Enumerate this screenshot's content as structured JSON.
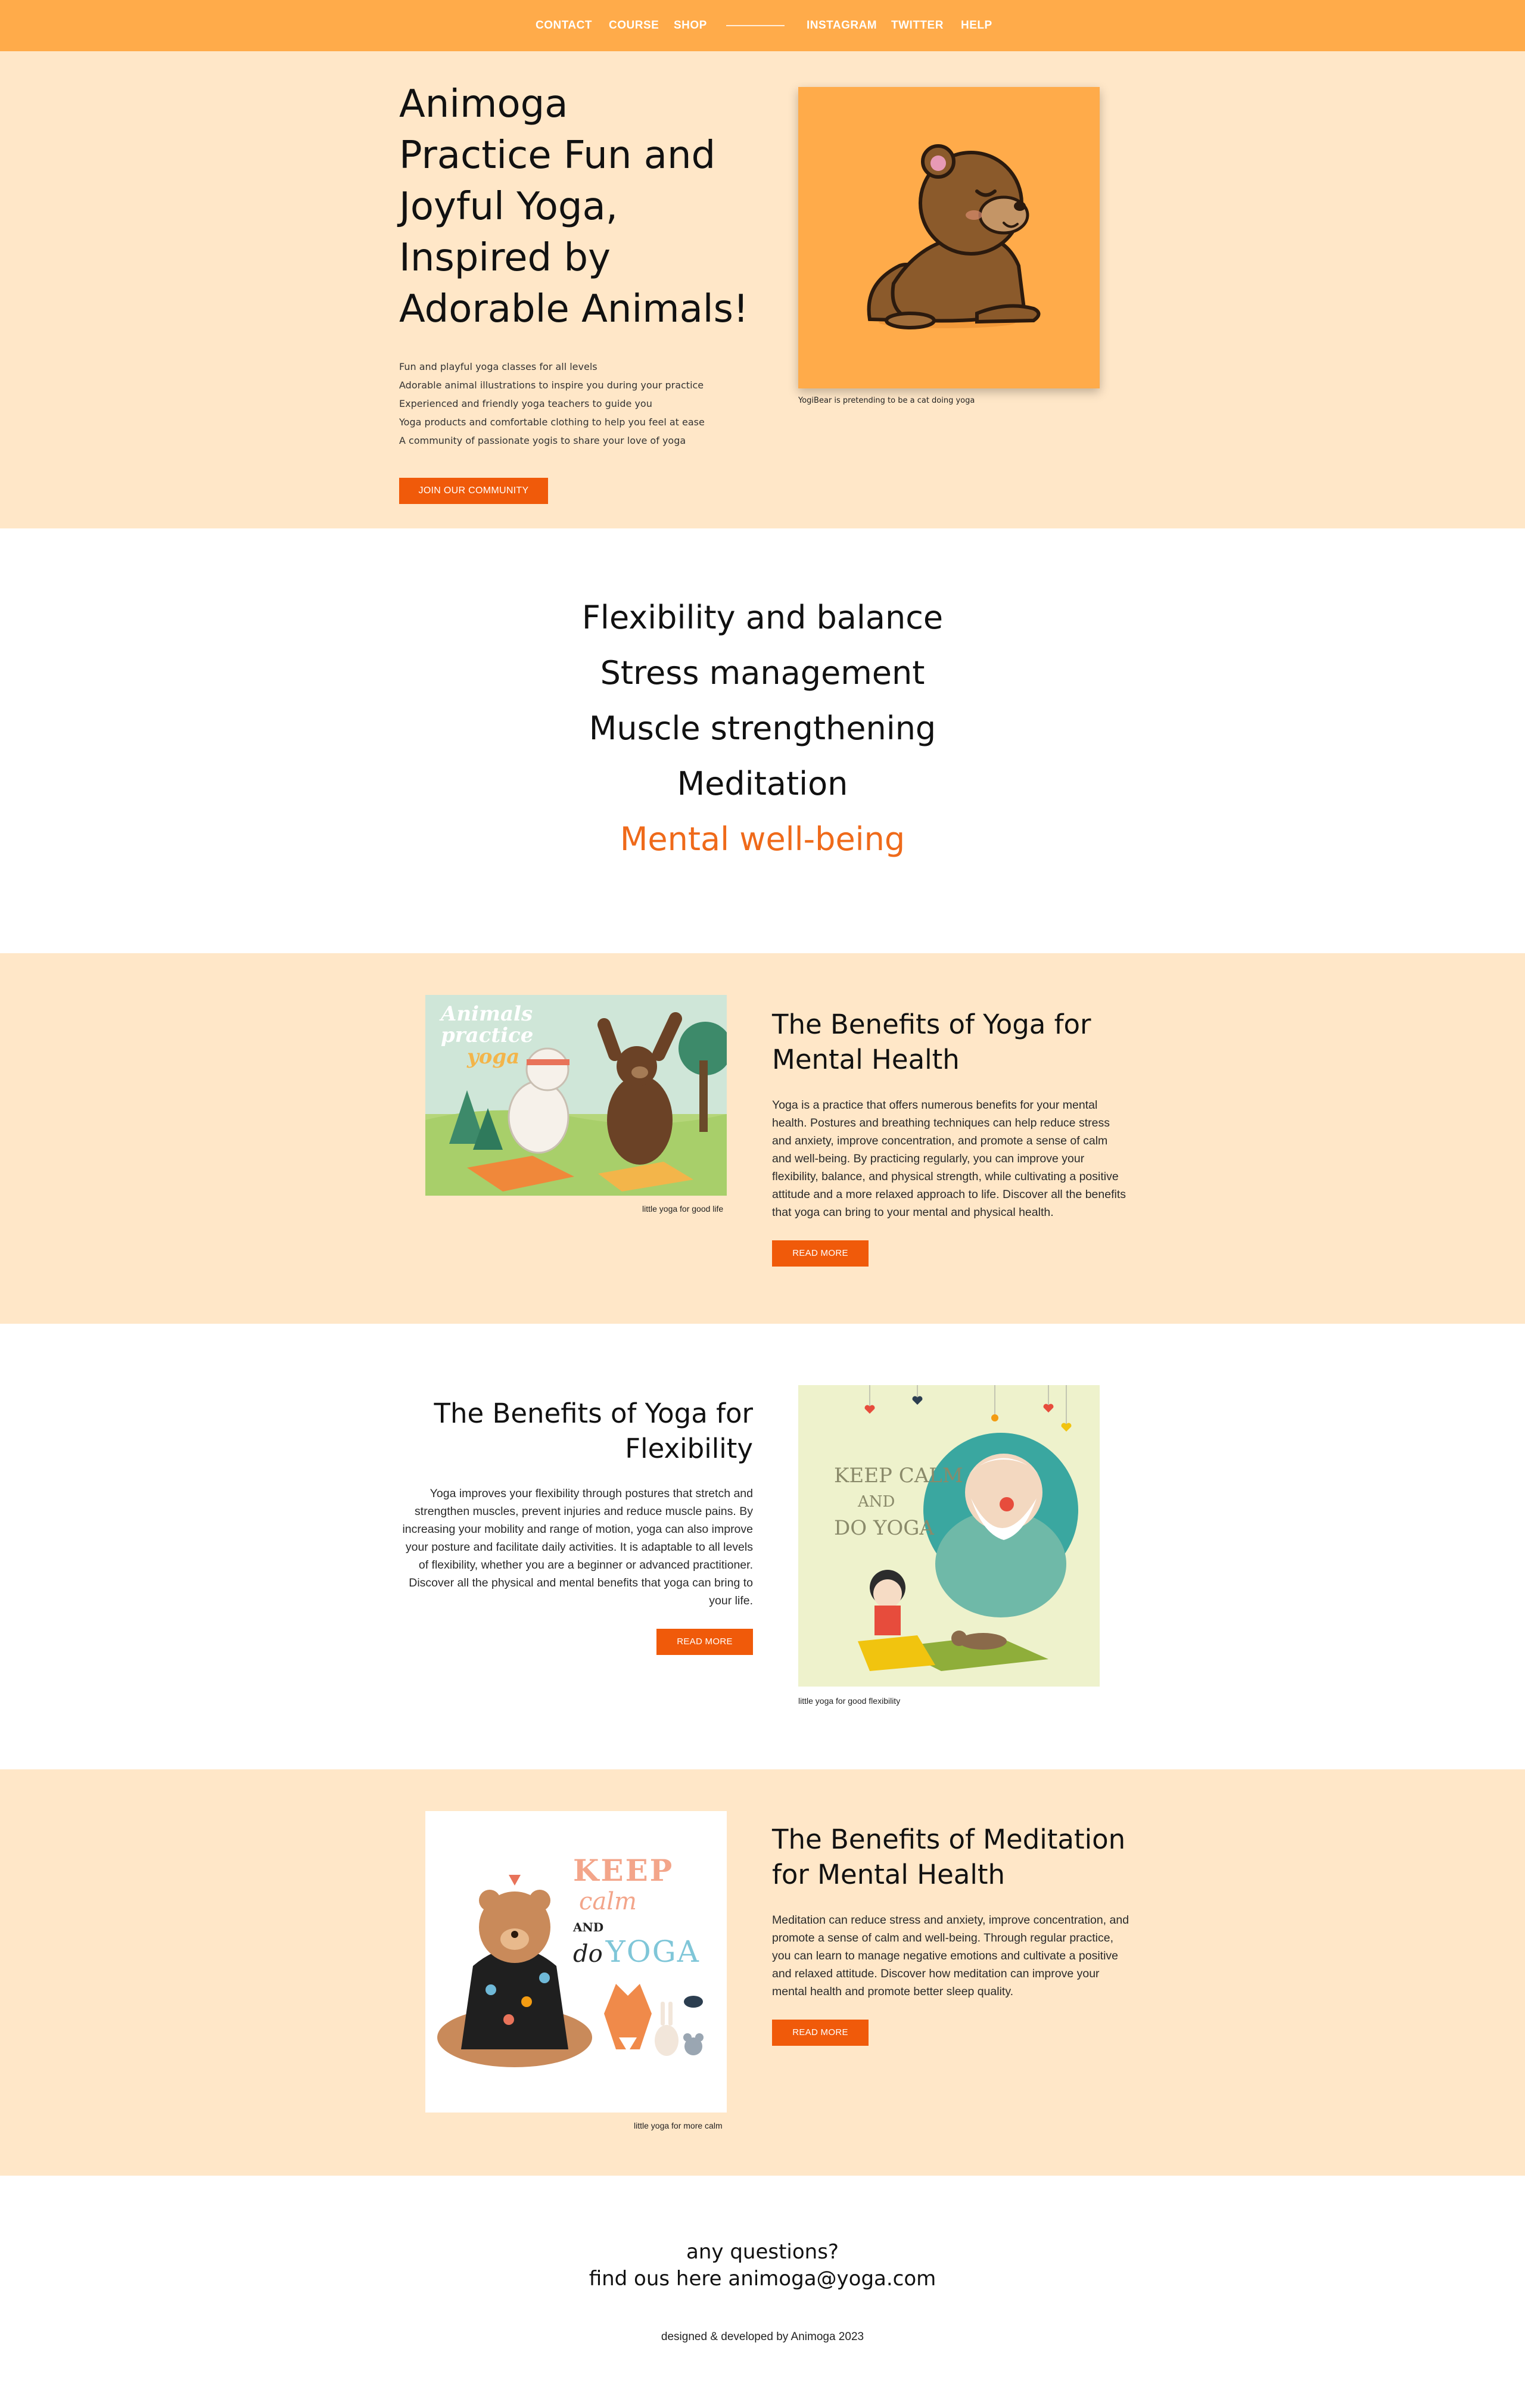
{
  "nav": {
    "links_left": [
      "CONTACT",
      "COURSE",
      "SHOP"
    ],
    "links_right": [
      "INSTAGRAM",
      "TWITTER",
      "HELP"
    ]
  },
  "hero": {
    "title_lines": [
      "Animoga",
      "Practice Fun and",
      "Joyful Yoga,",
      "Inspired by",
      "Adorable Animals!"
    ],
    "features": [
      "Fun and playful yoga classes for all levels",
      "Adorable animal illustrations to inspire you during your practice",
      "Experienced and friendly yoga teachers to guide you",
      "Yoga products and comfortable clothing to help you feel at ease",
      "A community of passionate yogis to share your love of yoga"
    ],
    "cta_label": "JOIN OUR COMMUNITY",
    "image_caption": "YogiBear is pretending to be a cat doing yoga"
  },
  "benefits": [
    "Flexibility and balance",
    "Stress management",
    "Muscle strengthening",
    "Meditation",
    "Mental well-being"
  ],
  "articles": [
    {
      "title": "The Benefits of Yoga for Mental Health",
      "body": "Yoga is a practice that offers numerous benefits for your mental health. Postures and breathing techniques can help reduce stress and anxiety, improve concentration, and promote a sense of calm and well-being. By practicing regularly, you can improve your flexibility, balance, and physical strength, while cultivating a positive attitude and a more relaxed approach to life. Discover all the benefits that yoga can bring to your mental and physical health.",
      "button": "READ MORE",
      "caption": "little yoga for good life",
      "image_text": [
        "Animals",
        "practice",
        "yoga"
      ]
    },
    {
      "title": "The Benefits of Yoga for Flexibility",
      "body": "Yoga improves your flexibility through postures that stretch and strengthen muscles, prevent injuries and reduce muscle pains. By increasing your mobility and range of motion, yoga can also improve your posture and facilitate daily activities. It is adaptable to all levels of flexibility, whether you are a beginner or advanced practitioner. Discover all the physical and mental benefits that yoga can bring to your life.",
      "button": "READ MORE",
      "caption": "little yoga for good flexibility",
      "image_text": [
        "KEEP CALM",
        "AND",
        "DO YOGA"
      ]
    },
    {
      "title": "The Benefits of Meditation for Mental Health",
      "body": "Meditation can reduce stress and anxiety, improve concentration, and promote a sense of calm and well-being. Through regular practice, you can learn to manage negative emotions and cultivate a positive and relaxed attitude. Discover how meditation can improve your mental health and promote better sleep quality.",
      "button": "READ MORE",
      "caption": "little yoga for more calm",
      "image_text": [
        "KEEP",
        "calm",
        "AND",
        "do",
        "YOGA"
      ]
    }
  ],
  "footer": {
    "line1": "any questions?",
    "line2": "find ous here animoga@yoga.com",
    "credit": "designed & developed by Animoga 2023"
  },
  "colors": {
    "nav_bg": "#ffab4a",
    "section_bg": "#ffe7c8",
    "accent": "#f05a0a",
    "highlight_text": "#ef6a1a"
  }
}
